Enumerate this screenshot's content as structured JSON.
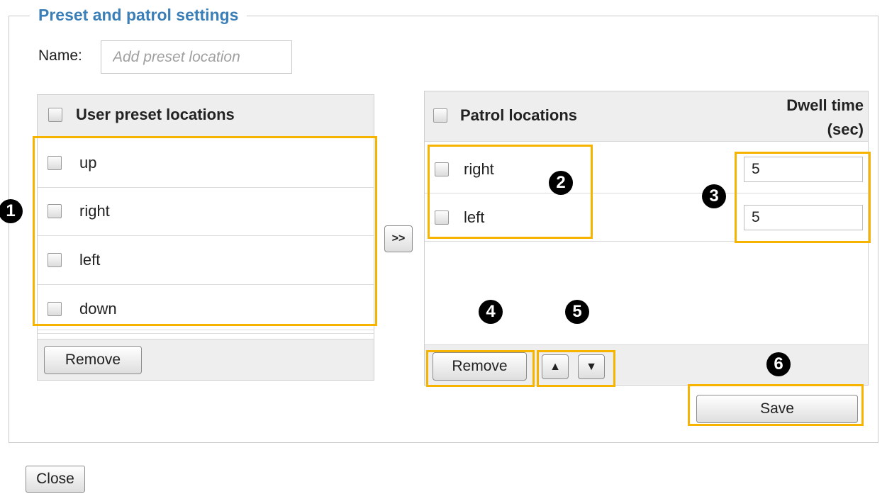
{
  "section": {
    "title": "Preset and patrol settings"
  },
  "name_field": {
    "label": "Name:",
    "placeholder": "Add preset location"
  },
  "user_presets": {
    "header": "User preset locations",
    "items": [
      {
        "label": "up"
      },
      {
        "label": "right"
      },
      {
        "label": "left"
      },
      {
        "label": "down"
      }
    ],
    "remove_label": "Remove"
  },
  "transfer_button": {
    "label": ">>"
  },
  "patrol": {
    "header": "Patrol locations",
    "dwell_header_line1": "Dwell time",
    "dwell_header_line2": "(sec)",
    "items": [
      {
        "label": "right",
        "dwell": "5"
      },
      {
        "label": "left",
        "dwell": "5"
      }
    ],
    "remove_label": "Remove",
    "move_up_label": "▲",
    "move_down_label": "▼"
  },
  "save_label": "Save",
  "close_label": "Close",
  "callouts": [
    "1",
    "2",
    "3",
    "4",
    "5",
    "6"
  ],
  "colors": {
    "highlight": "#f6b400",
    "legend": "#3a7fb8"
  }
}
